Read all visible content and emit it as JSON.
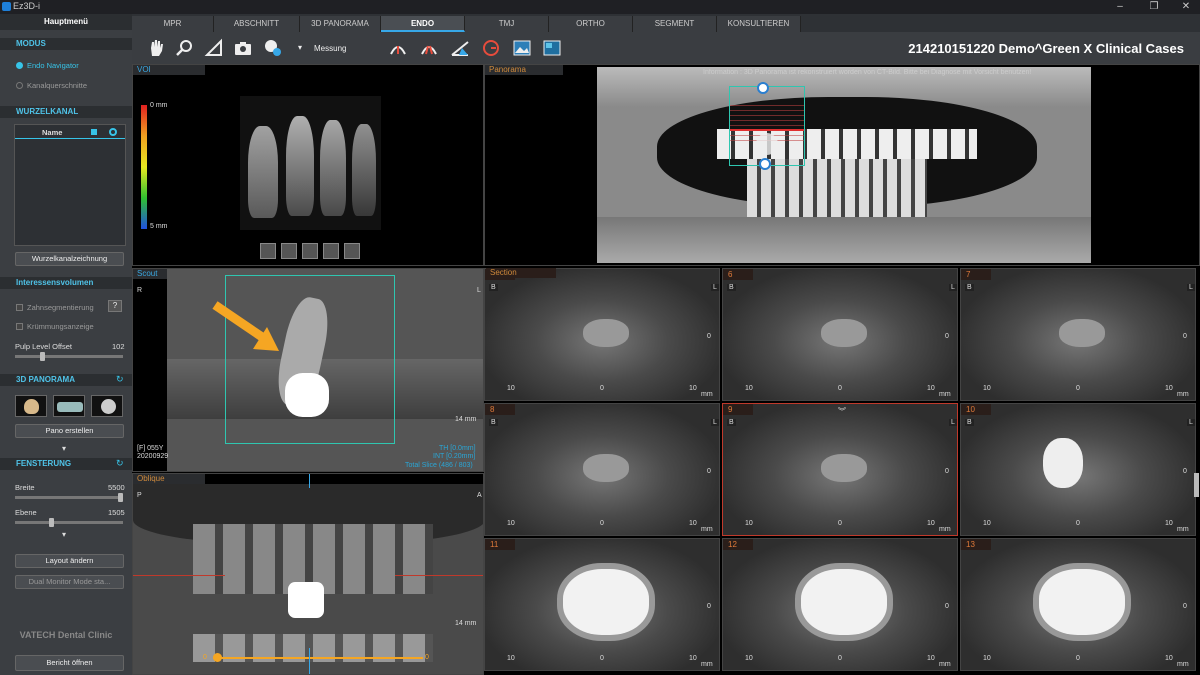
{
  "window": {
    "title": "Ez3D-i"
  },
  "left": {
    "main_menu": "Hauptmenü",
    "modus": {
      "title": "MODUS",
      "options": [
        "Endo Navigator",
        "Kanalquerschnitte"
      ]
    },
    "wurzelkanal": {
      "title": "WURZELKANAL",
      "col_name": "Name",
      "button": "Wurzelkanalzeichnung"
    },
    "interest": {
      "title": "Interessensvolumen",
      "zahn": "Zahnsegmentierung",
      "help": "?",
      "kruemmung": "Krümmungsanzeige",
      "pulp_label": "Pulp Level Offset",
      "pulp_value": "102"
    },
    "pano": {
      "title": "3D PANORAMA",
      "button": "Pano erstellen"
    },
    "fenster": {
      "title": "FENSTERUNG",
      "breite_label": "Breite",
      "breite_value": "5500",
      "ebene_label": "Ebene",
      "ebene_value": "1505"
    },
    "layout_button": "Layout ändern",
    "dual_button": "Dual Monitor Mode sta...",
    "brand": "VATECH Dental Clinic",
    "report_button": "Bericht öffnen"
  },
  "tabs": [
    "MPR",
    "ABSCHNITT",
    "3D PANORAMA",
    "ENDO",
    "TMJ",
    "ORTHO",
    "SEGMENT",
    "KONSULTIEREN"
  ],
  "active_tab": "ENDO",
  "toolbar": {
    "measure_label": "Messung",
    "case_title": "214210151220  Demo^Green X Clinical Cases"
  },
  "voi": {
    "label": "VOI",
    "scale_top": "0 mm",
    "scale_bottom": "5 mm"
  },
  "panorama": {
    "label": "Panorama",
    "info": "Information : 3D Panorama ist rekonstruiert worden von CT-Bild. Bitte bei Diagnose mit Vorsicht benutzen!"
  },
  "scout": {
    "label": "Scout",
    "left_mark": "R",
    "right_mark": "L",
    "mm": "14 mm",
    "info_left_1": "[F] 055Y",
    "info_left_2": "20200929",
    "info_right_1": "TH [0.0mm]",
    "info_right_2": "INT [0.20mm]",
    "info_right_3": "Total Slice (486 / 803)"
  },
  "oblique": {
    "label": "Oblique",
    "left_mark": "P",
    "right_mark": "A",
    "mm": "14 mm",
    "slider_start": "0",
    "slider_end": "0"
  },
  "section": {
    "label": "Section",
    "cells": [
      {
        "num": "5",
        "b": "B",
        "l": "L",
        "zero": "0",
        "left": "10",
        "mid": "0",
        "right": "10",
        "mm": "mm"
      },
      {
        "num": "6",
        "b": "B",
        "l": "L",
        "zero": "0",
        "left": "10",
        "mid": "0",
        "right": "10",
        "mm": "mm"
      },
      {
        "num": "7",
        "b": "B",
        "l": "L",
        "zero": "0",
        "left": "10",
        "mid": "0",
        "right": "10",
        "mm": "mm"
      },
      {
        "num": "8",
        "b": "B",
        "l": "L",
        "zero": "0",
        "left": "10",
        "mid": "0",
        "right": "10",
        "mm": "mm"
      },
      {
        "num": "9",
        "b": "B",
        "l": "L",
        "zero": "0",
        "left": "10",
        "mid": "0",
        "right": "10",
        "mm": "mm"
      },
      {
        "num": "10",
        "b": "B",
        "l": "L",
        "zero": "0",
        "left": "10",
        "mid": "0",
        "right": "10",
        "mm": "mm"
      },
      {
        "num": "11",
        "b": "",
        "l": "",
        "zero": "0",
        "left": "10",
        "mid": "0",
        "right": "10",
        "mm": "mm"
      },
      {
        "num": "12",
        "b": "",
        "l": "",
        "zero": "0",
        "left": "10",
        "mid": "0",
        "right": "10",
        "mm": "mm"
      },
      {
        "num": "13",
        "b": "",
        "l": "",
        "zero": "0",
        "left": "10",
        "mid": "0",
        "right": "10",
        "mm": "mm"
      }
    ]
  },
  "colors": {
    "accent": "#37a8e8",
    "orange": "#f5a623",
    "teal": "#2fc6b0",
    "red_line": "#c0392b"
  }
}
